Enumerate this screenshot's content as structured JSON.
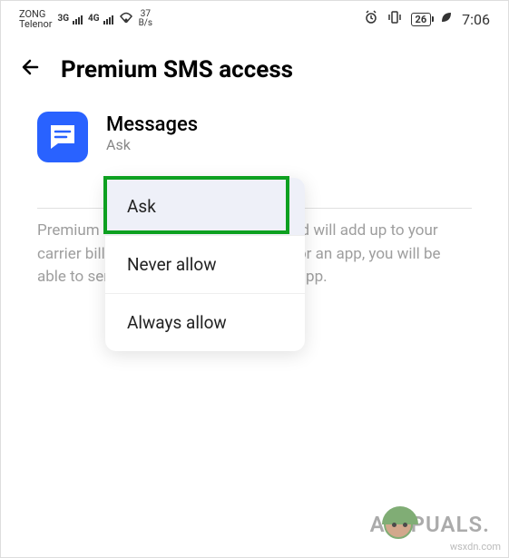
{
  "status_bar": {
    "carrier1": "ZONG",
    "carrier2": "Telenor",
    "net1": "3G",
    "net2": "4G",
    "speed_value": "37",
    "speed_unit": "B/s",
    "battery": "26",
    "time": "7:06"
  },
  "header": {
    "title": "Premium SMS access"
  },
  "app": {
    "name": "Messages",
    "status": "Ask"
  },
  "description": "Premium SMS may cost you money and will add up to your carrier bills. If you enable permission for an app, you will be able to send premium SMS using that app.",
  "popup": {
    "items": [
      {
        "label": "Ask",
        "selected": true
      },
      {
        "label": "Never allow",
        "selected": false
      },
      {
        "label": "Always allow",
        "selected": false
      }
    ]
  },
  "watermark": {
    "brand_left": "A",
    "brand_right": "PUALS.",
    "url": "wsxdn.com"
  }
}
